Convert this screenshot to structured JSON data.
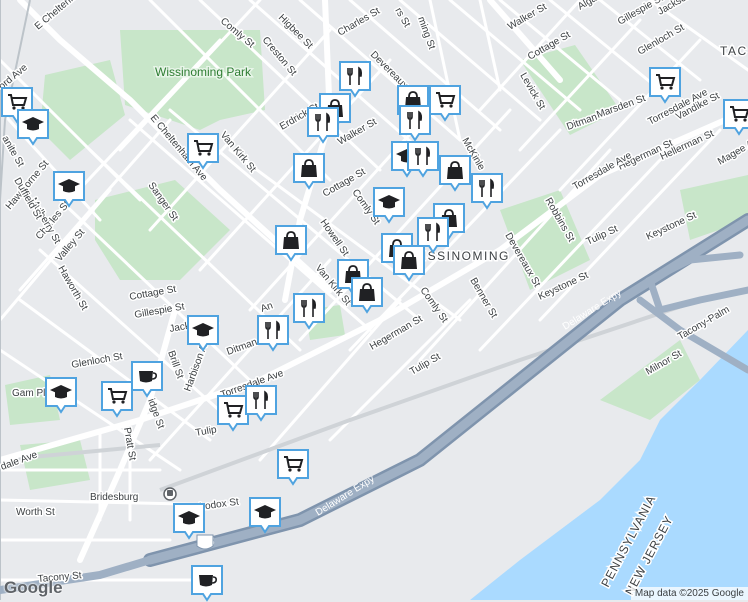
{
  "map": {
    "attribution": "Map data ©2025 Google",
    "logo": "Google",
    "labels": {
      "charles_st_n": "Charles St",
      "devereaux_st_n": "Devereaux St",
      "higbee_st": "Higbee St",
      "comly_st_nw": "Comly St",
      "creston_st": "Creston St",
      "walker_st_n": "Walker St",
      "cottage_st_ne": "Cottage St",
      "glenloch_st_ne": "Glenloch St",
      "gillespie_st_ne": "Gillespie St",
      "jackson_st_ne": "Jackson",
      "algard": "Alga",
      "levick_st": "Levick St",
      "taco": "TAC",
      "ditman_st_e": "Ditman St",
      "marsden_st": "Marsden St",
      "torresdale_ave_e": "Torresdale Ave",
      "vandike_st": "Vandike St",
      "hegerman_st_e": "Hegerman St",
      "hellerman_st": "Hellerman St",
      "magee_ave": "Magee Ave",
      "robbins_st": "Robbins St",
      "mckinley_st": "McKinle",
      "torresdale_ave_c": "Torresdale Ave",
      "keystone_st_e": "Keystone St",
      "tulip_st_e": "Tulip St",
      "devereaux_st_c": "Devereaux St",
      "keystone_st_c": "Keystone St",
      "benner_st": "Benner St",
      "wissinoming": "WISSINOMING",
      "comly_st_c": "Comly St",
      "hegerman_st_c": "Hegerman St",
      "tulip_st_c": "Tulip St",
      "delaware_expy_1": "Delaware Expy",
      "delaware_expy_2": "Delaware Expy",
      "tacony_palmyra": "Tacony-Palm",
      "milnor_st": "Milnor St",
      "wissinoming_park": "Wissinoming Park",
      "e_cheltenham_ave_n": "E Cheltenham Ave",
      "e_cheltenham_ave_c": "E Cheltenham Ave",
      "van_kirk_st_n": "Van Kirk St",
      "erdrick_st": "Erdrick St",
      "cottage_st_c": "Cottage St",
      "walker_st_c": "Walker St",
      "comly_st_cc": "Comly St",
      "howell_st": "Howell St",
      "van_kirk_st_c": "Van Kirk St",
      "sanger_st": "Sanger St",
      "charles_st_w": "Charles St",
      "valley_st": "Valley St",
      "haworth_st": "Haworth St",
      "mulberry_st": "Mulberry St",
      "hawthorne_st": "Hawthorne St",
      "duffield_st": "Duffield St",
      "sanite_st": "anite St",
      "ord_ave": "ord Ave",
      "cottage_st_w": "Cottage St",
      "gillespie_st_w": "Gillespie St",
      "jackson_st_w": "Jackson St",
      "harbison_ave": "Harbison Ave",
      "glenloch_st_w": "Glenloch St",
      "brill_st": "Brill St",
      "ditman_st_w": "Ditman",
      "an_st": "An",
      "torresdale_ave_w": "Torresdale Ave",
      "tulip_st_w": "Tulip",
      "ridge_st": "idge St",
      "pratt_st": "Pratt St",
      "dale_ave": "dale Ave",
      "game_playground": "Gam Playgr",
      "bridesburg": "Bridesburg",
      "worth_st": "Worth St",
      "orthodox_st": "hodox St",
      "tacony_st": "Tacony St",
      "i95": "95",
      "pennsylvania": "PENNSYLVANIA",
      "new_jersey": "NEW JERSEY",
      "wissinoming_st_n": "ming St",
      "margaret_st": "rs St"
    }
  }
}
